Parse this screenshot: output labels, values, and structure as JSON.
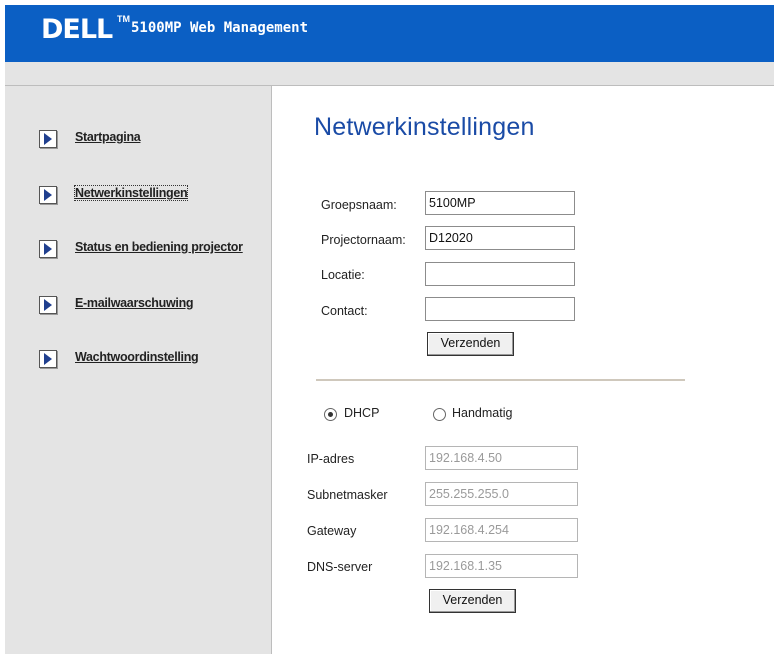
{
  "header": {
    "logo": "DELL",
    "trademark": "TM",
    "title": "5100MP Web Management",
    "color": "#0b5fc4"
  },
  "sidebar": {
    "items": [
      {
        "label": "Startpagina",
        "icon": "arrow-right-icon"
      },
      {
        "label": "Netwerkinstellingen",
        "icon": "arrow-right-icon",
        "active": true
      },
      {
        "label": "Status en bediening projector",
        "icon": "arrow-right-icon"
      },
      {
        "label": "E-mailwaarschuwing",
        "icon": "arrow-right-icon"
      },
      {
        "label": "Wachtwoordinstelling",
        "icon": "arrow-right-icon"
      }
    ]
  },
  "main": {
    "heading": "Netwerkinstellingen",
    "general": {
      "group_label": "Groepsnaam:",
      "group_value": "5100MP",
      "projector_label": "Projectornaam:",
      "projector_value": "D12020",
      "location_label": "Locatie:",
      "location_value": "",
      "contact_label": "Contact:",
      "contact_value": "",
      "submit_label": "Verzenden"
    },
    "network": {
      "dhcp_label": "DHCP",
      "manual_label": "Handmatig",
      "selected": "DHCP",
      "ip_label": "IP-adres",
      "ip_value": "192.168.4.50",
      "subnet_label": "Subnetmasker",
      "subnet_value": "255.255.255.0",
      "gateway_label": "Gateway",
      "gateway_value": "192.168.4.254",
      "dns_label": "DNS-server",
      "dns_value": "192.168.1.35",
      "submit_label": "Verzenden"
    }
  }
}
